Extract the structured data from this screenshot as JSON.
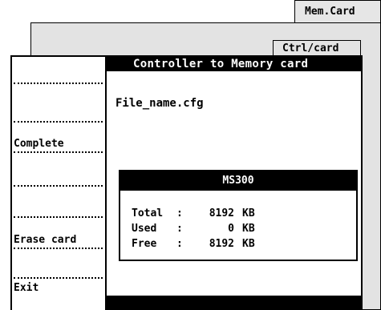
{
  "tabs": {
    "mem_card": "Mem.Card",
    "ctrl_card": "Ctrl/card"
  },
  "header": {
    "title": "Controller to Memory card"
  },
  "menu": {
    "items": [
      {
        "label": ""
      },
      {
        "label": ""
      },
      {
        "label": "Complete"
      },
      {
        "label": ""
      },
      {
        "label": ""
      },
      {
        "label": "Erase card"
      },
      {
        "label": "Exit"
      }
    ]
  },
  "main": {
    "file_name": "File_name.cfg"
  },
  "dialog": {
    "title": "MS300",
    "rows": [
      {
        "label": "Total",
        "sep": ":",
        "value": "8192",
        "unit": "KB"
      },
      {
        "label": "Used",
        "sep": ":",
        "value": "0",
        "unit": "KB"
      },
      {
        "label": "Free",
        "sep": ":",
        "value": "8192",
        "unit": "KB"
      }
    ]
  },
  "colors": {
    "background": "#ffffff",
    "window_gray": "#e3e3e3",
    "bar": "#000000"
  }
}
